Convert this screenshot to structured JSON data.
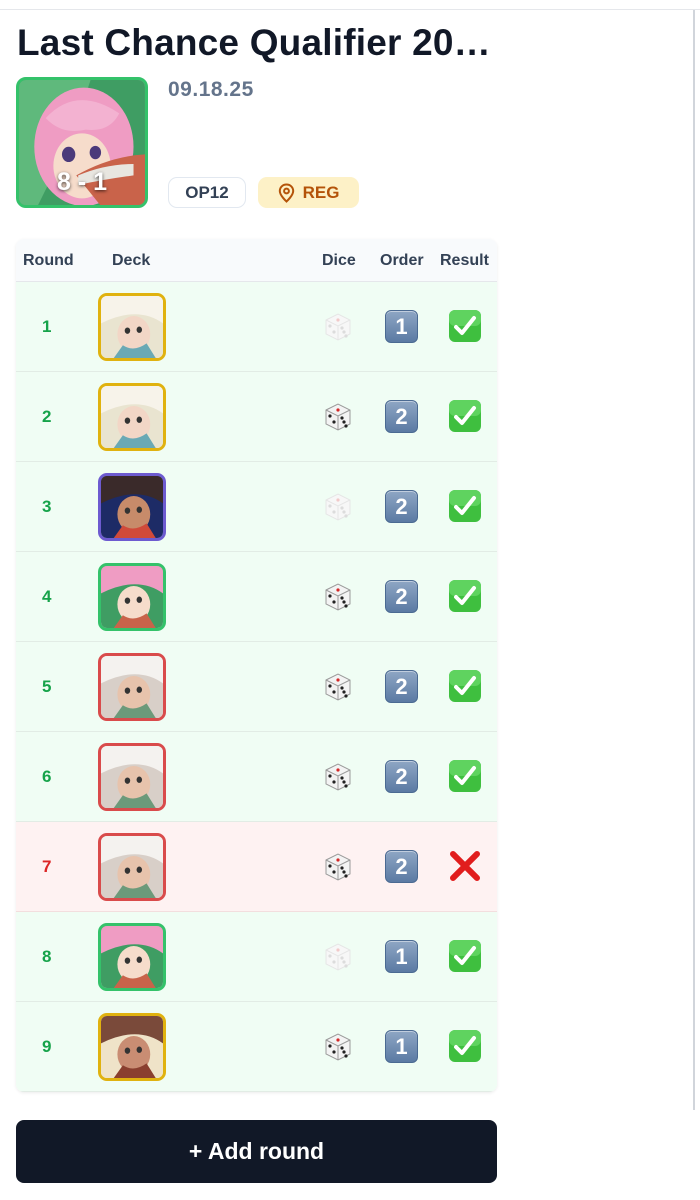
{
  "event": {
    "title": "Last Chance Qualifier 20…",
    "date": "09.18.25",
    "record": "8 - 1",
    "set_code": "OP12",
    "type_label": "REG",
    "hero_leader_icon": "pink-haired-leader-portrait",
    "hero_border_color": "#34c26a"
  },
  "table": {
    "headers": {
      "round": "Round",
      "deck": "Deck",
      "dice": "Dice",
      "order": "Order",
      "result": "Result"
    },
    "rows": [
      {
        "round": "1",
        "deck_icon": "yellow-white-haired-leader-portrait",
        "deck_color": "#e0b20f",
        "dice": "lost",
        "order": "1",
        "result": "win"
      },
      {
        "round": "2",
        "deck_icon": "yellow-white-haired-leader-portrait",
        "deck_color": "#e0b20f",
        "dice": "won",
        "order": "2",
        "result": "win"
      },
      {
        "round": "3",
        "deck_icon": "blue-purple-bearded-leader-portrait",
        "deck_color": "#6d5bd0",
        "dice": "lost",
        "order": "2",
        "result": "win"
      },
      {
        "round": "4",
        "deck_icon": "pink-haired-leader-portrait",
        "deck_color": "#34c26a",
        "dice": "won",
        "order": "2",
        "result": "win"
      },
      {
        "round": "5",
        "deck_icon": "white-haired-old-man-leader-portrait",
        "deck_color": "#d94b4b",
        "dice": "won",
        "order": "2",
        "result": "win"
      },
      {
        "round": "6",
        "deck_icon": "white-haired-old-man-leader-portrait",
        "deck_color": "#d94b4b",
        "dice": "won",
        "order": "2",
        "result": "win"
      },
      {
        "round": "7",
        "deck_icon": "white-haired-old-man-leader-portrait",
        "deck_color": "#d94b4b",
        "dice": "won",
        "order": "2",
        "result": "loss"
      },
      {
        "round": "8",
        "deck_icon": "pink-haired-leader-portrait",
        "deck_color": "#34c26a",
        "dice": "lost",
        "order": "1",
        "result": "win"
      },
      {
        "round": "9",
        "deck_icon": "yellow-scarfed-leader-portrait",
        "deck_color": "#e0b20f",
        "dice": "won",
        "order": "1",
        "result": "win"
      }
    ]
  },
  "actions": {
    "add_round_label": "+ Add round"
  },
  "colors": {
    "win_text": "#16a34a",
    "loss_text": "#dc2626",
    "win_row": "#f0fdf4",
    "loss_row": "#fef2f2",
    "button_bg": "#111827",
    "reg_chip_bg": "#fdf1c7",
    "reg_chip_text": "#b45309"
  }
}
